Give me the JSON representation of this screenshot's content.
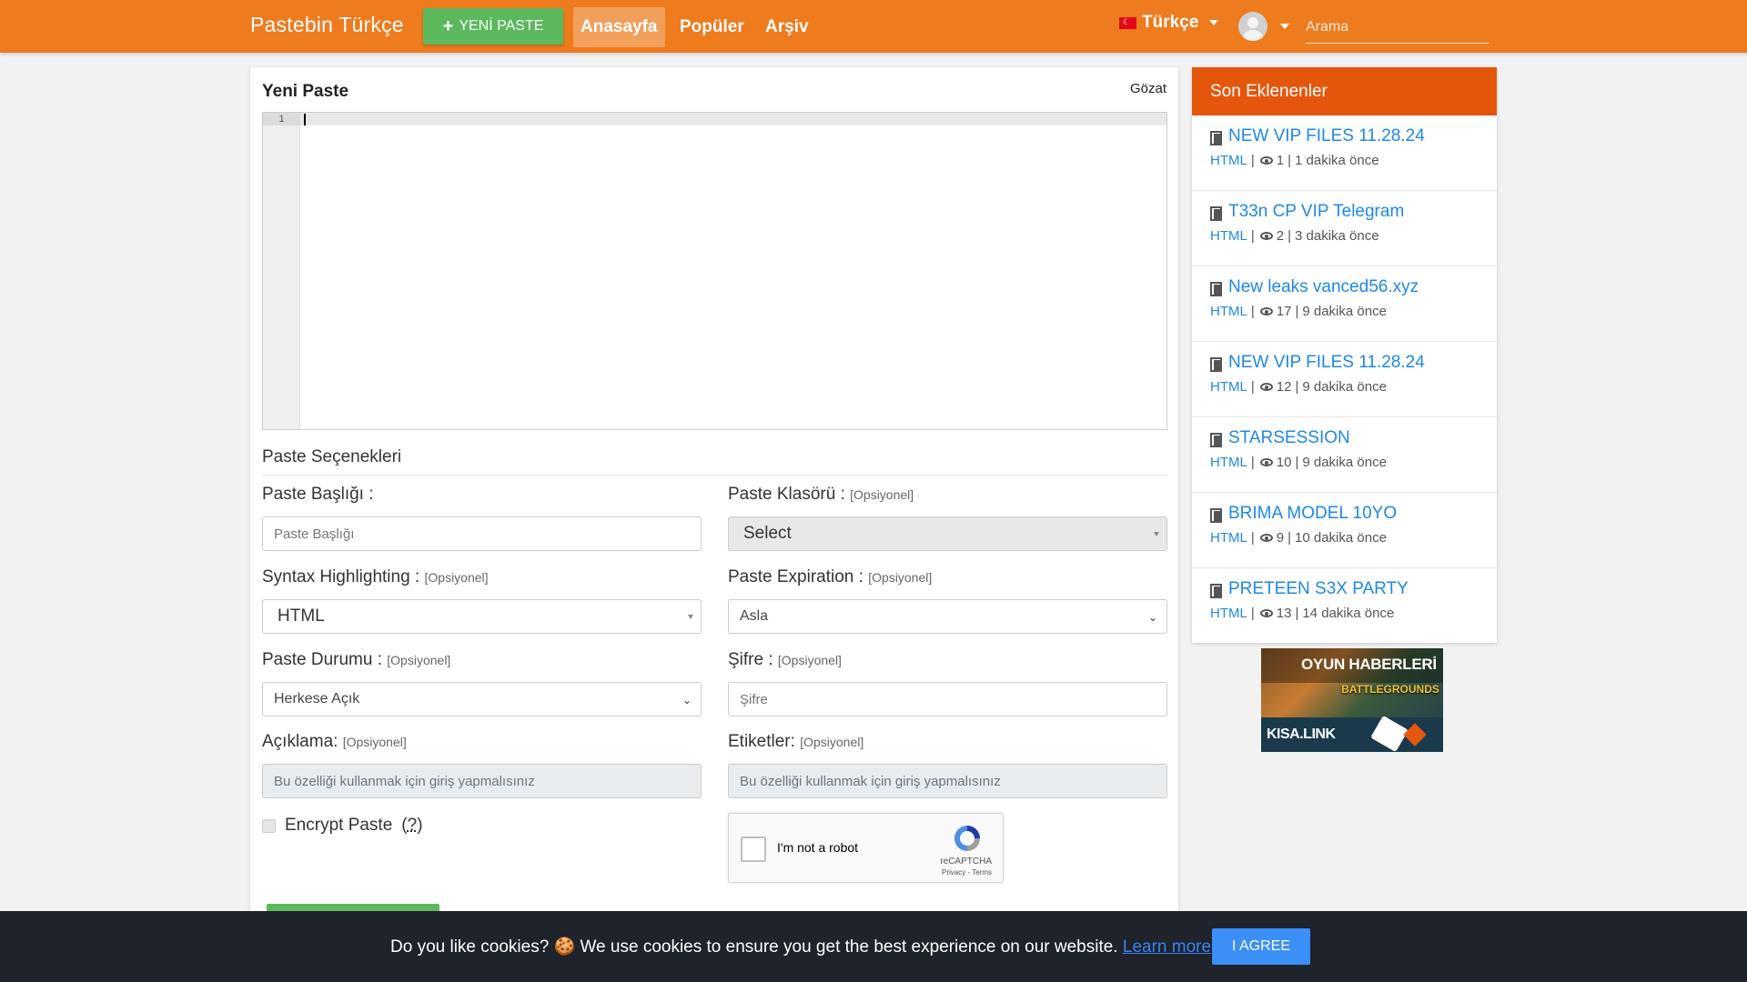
{
  "navbar": {
    "brand": "Pastebin Türkçe",
    "new_paste_label": "YENİ PASTE",
    "links": [
      "Anasayfa",
      "Popüler",
      "Arşiv"
    ],
    "language": "Türkçe",
    "search_placeholder": "Arama",
    "colors": {
      "bar": "#ee7b1d",
      "new_button": "#5cb85c"
    }
  },
  "main": {
    "title": "Yeni Paste",
    "browse": "Gözat",
    "editor": {
      "line_numbers": [
        "1"
      ]
    },
    "section_title": "Paste Seçenekleri",
    "optional": "[Opsiyonel]",
    "fields": {
      "title_label": "Paste Başlığı :",
      "title_placeholder": "Paste Başlığı",
      "folder_label": "Paste Klasörü :",
      "folder_value": "Select",
      "syntax_label": "Syntax Highlighting :",
      "syntax_value": "HTML",
      "expiration_label": "Paste Expiration :",
      "expiration_value": "Asla",
      "status_label": "Paste Durumu :",
      "status_value": "Herkese Açık",
      "password_label": "Şifre :",
      "password_placeholder": "Şifre",
      "description_label": "Açıklama:",
      "description_placeholder": "Bu özelliği kullanmak için giriş yapmalısınız",
      "tags_label": "Etiketler:",
      "tags_placeholder": "Bu özelliği kullanmak için giriş yapmalısınız"
    },
    "encrypt_label": "Encrypt Paste",
    "encrypt_help": "?",
    "recaptcha": {
      "label": "I'm not a robot",
      "brand": "reCAPTCHA",
      "terms": "Privacy - Terms"
    }
  },
  "sidebar": {
    "title": "Son Eklenenler",
    "header_color": "#e5560d",
    "items": [
      {
        "title": "NEW VIP FILES 11.28.24",
        "syntax": "HTML",
        "views": "1",
        "time": "1 dakika önce"
      },
      {
        "title": "T33n CP VIP Telegram",
        "syntax": "HTML",
        "views": "2",
        "time": "3 dakika önce"
      },
      {
        "title": "New leaks vanced56.xyz",
        "syntax": "HTML",
        "views": "17",
        "time": "9 dakika önce"
      },
      {
        "title": "NEW VIP FILES 11.28.24",
        "syntax": "HTML",
        "views": "12",
        "time": "9 dakika önce"
      },
      {
        "title": "STARSESSION",
        "syntax": "HTML",
        "views": "10",
        "time": "9 dakika önce"
      },
      {
        "title": "BRIMA MODEL 10YO",
        "syntax": "HTML",
        "views": "9",
        "time": "10 dakika önce"
      },
      {
        "title": "PRETEEN S3X PARTY",
        "syntax": "HTML",
        "views": "13",
        "time": "14 dakika önce"
      }
    ]
  },
  "ad": {
    "title": "OYUN HABERLERİ",
    "game": "BATTLEGROUNDS",
    "link": "KISA.LINK"
  },
  "cookie": {
    "text": "Do you like cookies? 🍪 We use cookies to ensure you get the best experience on our website.",
    "learn_more": "Learn more",
    "agree": "I AGREE"
  }
}
